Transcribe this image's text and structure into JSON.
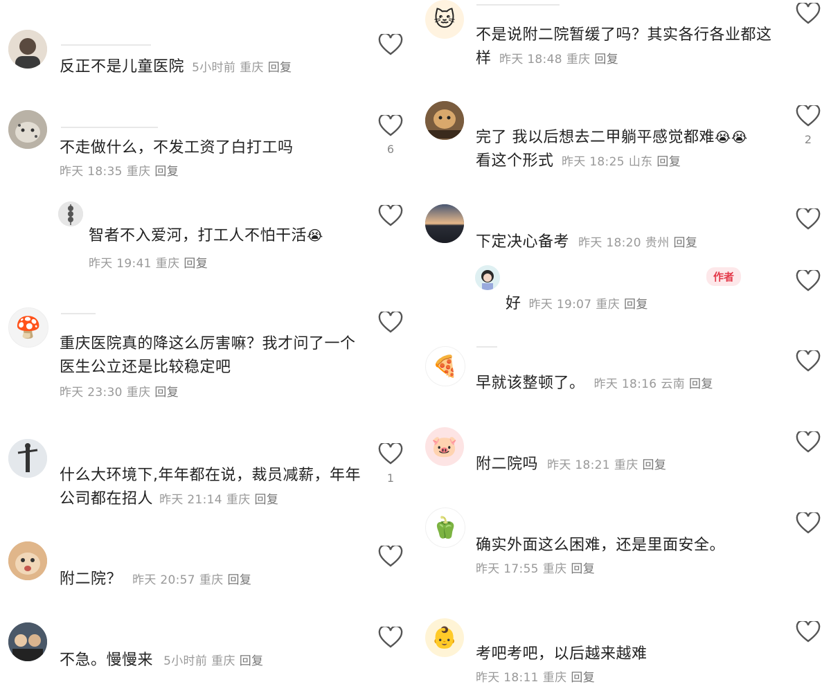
{
  "left": [
    {
      "text": "反正不是儿童医院",
      "meta": {
        "time": "5小时前",
        "location": "重庆",
        "reply": "回复"
      },
      "likes": "",
      "avatar": "person-avatar"
    },
    {
      "text": "不走做什么，不发工资了白打工吗",
      "meta": {
        "time": "昨天 18:35",
        "location": "重庆",
        "reply": "回复"
      },
      "likes": "6",
      "avatar": "snow-leopard-avatar"
    },
    {
      "text": "智者不入爱河，打工人不怕干活",
      "emoji": "😭",
      "meta": {
        "time": "昨天 19:41",
        "location": "重庆",
        "reply": "回复"
      },
      "likes": "",
      "avatar": "tanghulu-avatar"
    },
    {
      "text": "重庆医院真的降这么厉害嘛？我才问了一个医生公立还是比较稳定吧",
      "meta": {
        "time": "昨天 23:30",
        "location": "重庆",
        "reply": "回复"
      },
      "likes": "",
      "avatar": "mushroom-avatar",
      "avatar_glyph": "🍄"
    },
    {
      "text": "什么大环境下,年年都在说，裁员减薪，年年公司都在招人",
      "meta": {
        "time": "昨天 21:14",
        "location": "重庆",
        "reply": "回复"
      },
      "likes": "1",
      "avatar": "statue-avatar"
    },
    {
      "text": "附二院？",
      "meta": {
        "time": "昨天 20:57",
        "location": "重庆",
        "reply": "回复"
      },
      "likes": "",
      "avatar": "cat-avatar"
    },
    {
      "text": "不急。慢慢来",
      "meta": {
        "time": "5小时前",
        "location": "重庆",
        "reply": "回复"
      },
      "likes": "",
      "avatar": "group-avatar"
    }
  ],
  "right": [
    {
      "text": "不是说附二院暂缓了吗？其实各行各业都这样",
      "meta": {
        "time": "昨天 18:48",
        "location": "重庆",
        "reply": "回复"
      },
      "likes": "",
      "avatar": "cartoon-cat-avatar",
      "avatar_glyph": "🐱"
    },
    {
      "text": "完了 我以后想去二甲躺平感觉都难",
      "emoji": "😭😭",
      "text2": "看这个形式",
      "meta": {
        "time": "昨天 18:25",
        "location": "山东",
        "reply": "回复"
      },
      "likes": "2",
      "avatar": "dog-avatar"
    },
    {
      "text": "下定决心备考",
      "meta": {
        "time": "昨天 18:20",
        "location": "贵州",
        "reply": "回复"
      },
      "likes": "",
      "avatar": "sunset-avatar"
    },
    {
      "text": "好",
      "meta": {
        "time": "昨天 19:07",
        "location": "重庆",
        "reply": "回复"
      },
      "likes": "",
      "avatar": "girl-avatar",
      "tag": "作者"
    },
    {
      "text": "早就该整顿了。",
      "meta": {
        "time": "昨天 18:16",
        "location": "云南",
        "reply": "回复"
      },
      "likes": "",
      "avatar": "pizza-avatar",
      "avatar_glyph": "🍕"
    },
    {
      "text": "附二院吗",
      "meta": {
        "time": "昨天 18:21",
        "location": "重庆",
        "reply": "回复"
      },
      "likes": "",
      "avatar": "pig-avatar",
      "avatar_glyph": "🐷"
    },
    {
      "text": "确实外面这么困难，还是里面安全。",
      "meta": {
        "time": "昨天 17:55",
        "location": "重庆",
        "reply": "回复"
      },
      "likes": "",
      "avatar": "pepper-avatar",
      "avatar_glyph": "🫑"
    },
    {
      "text": "考吧考吧，以后越来越难",
      "meta": {
        "time": "昨天 18:11",
        "location": "重庆",
        "reply": "回复"
      },
      "likes": "",
      "avatar": "baby-avatar",
      "avatar_glyph": "👶"
    }
  ],
  "colors": {
    "text": "#222222",
    "meta": "#999999",
    "heart": "#555555",
    "tag_bg": "#fde8ea",
    "tag_text": "#e33a4a"
  }
}
